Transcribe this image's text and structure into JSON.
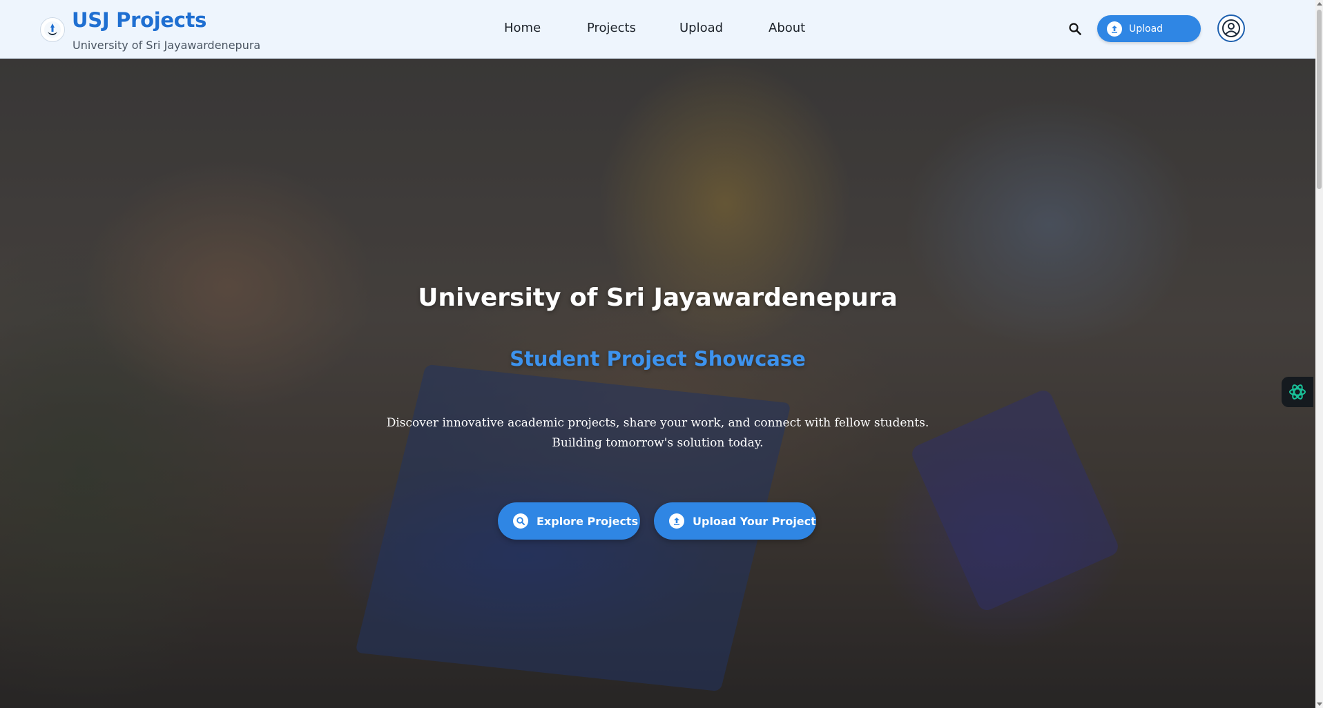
{
  "header": {
    "brand_title": "USJ Projects",
    "brand_subtitle": "University of Sri Jayawardenepura",
    "nav": [
      {
        "label": "Home"
      },
      {
        "label": "Projects"
      },
      {
        "label": "Upload"
      },
      {
        "label": "About"
      }
    ],
    "search_icon": "search-icon",
    "upload_button_label": "Upload",
    "account_icon": "user-circle-icon"
  },
  "hero": {
    "title": "University of Sri Jayawardenepura",
    "subtitle": "Student Project Showcase",
    "description_line1": "Discover innovative academic projects, share your work, and connect with fellow students.",
    "description_line2": "Building tomorrow's solution today.",
    "explore_button_label": "Explore Projects",
    "upload_project_button_label": "Upload Your Project"
  },
  "colors": {
    "brand": "#1f6fd1",
    "accent": "#2f86e4",
    "subtitle": "#3d93ee",
    "header_bg": "#eef5fd"
  }
}
